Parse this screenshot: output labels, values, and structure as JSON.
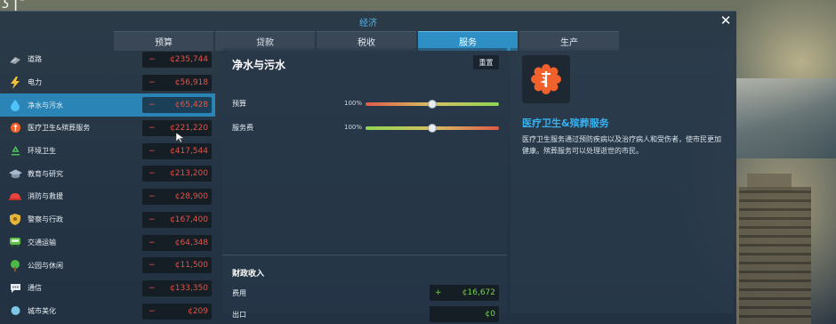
{
  "window": {
    "title": "经济",
    "close_label": "✕"
  },
  "tabs": [
    {
      "label": "预算",
      "active": false
    },
    {
      "label": "贷款",
      "active": false
    },
    {
      "label": "税收",
      "active": false
    },
    {
      "label": "服务",
      "active": true
    },
    {
      "label": "生产",
      "active": false
    }
  ],
  "services": [
    {
      "label": "道路",
      "icon": "road-icon",
      "sign": "−",
      "value": "¢235,744"
    },
    {
      "label": "电力",
      "icon": "electricity-icon",
      "sign": "−",
      "value": "¢56,918"
    },
    {
      "label": "净水与污水",
      "icon": "water-drop-icon",
      "sign": "−",
      "value": "¢65,428",
      "selected": true
    },
    {
      "label": "医疗卫生&殡葬服务",
      "icon": "healthcare-icon",
      "sign": "−",
      "value": "¢221,220"
    },
    {
      "label": "环境卫生",
      "icon": "recycle-icon",
      "sign": "−",
      "value": "¢417,544"
    },
    {
      "label": "教育与研究",
      "icon": "graduation-cap-icon",
      "sign": "−",
      "value": "¢213,200"
    },
    {
      "label": "消防与救援",
      "icon": "fire-helmet-icon",
      "sign": "−",
      "value": "¢28,900"
    },
    {
      "label": "警察与行政",
      "icon": "police-badge-icon",
      "sign": "−",
      "value": "¢167,400"
    },
    {
      "label": "交通运输",
      "icon": "bus-icon",
      "sign": "−",
      "value": "¢64,348"
    },
    {
      "label": "公园与休闲",
      "icon": "tree-icon",
      "sign": "−",
      "value": "¢11,500"
    },
    {
      "label": "通信",
      "icon": "chat-icon",
      "sign": "−",
      "value": "¢133,350"
    },
    {
      "label": "城市美化",
      "icon": "decoration-icon",
      "sign": "−",
      "value": "¢209"
    }
  ],
  "detail": {
    "title": "净水与污水",
    "reset_label": "重置",
    "budget_label": "预算",
    "budget_pct": "100%",
    "budget_level": 0.5,
    "fee_label": "服务费",
    "fee_pct": "100%",
    "fee_level": 0.5,
    "revenue_title": "财政收入",
    "fee_revenue_label": "费用",
    "fee_revenue_sign": "+",
    "fee_revenue_value": "¢16,672",
    "export_label": "出口",
    "export_value": "¢0"
  },
  "info": {
    "icon": "healthcare-icon",
    "title": "医疗卫生&殡葬服务",
    "description": "医疗卫生服务通过预防疾病以及治疗病人和受伤者，使市民更加健康。殡葬服务可以处理逝世的市民。"
  },
  "colors": {
    "accent": "#2e8fc4",
    "negative": "#e4544a",
    "positive": "#7ad24f",
    "info_title": "#39b1ee",
    "healthcare_orange": "#f0612c"
  }
}
